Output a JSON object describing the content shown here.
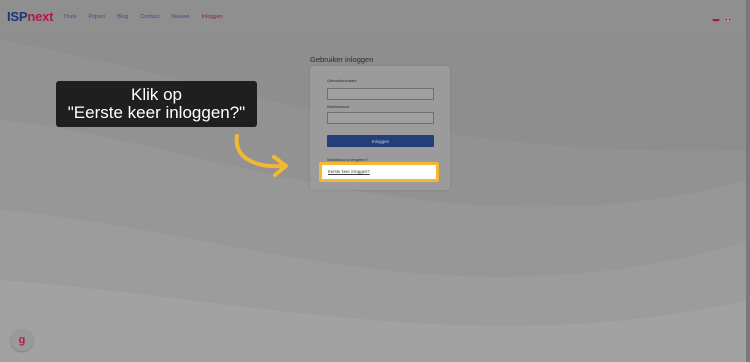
{
  "header": {
    "logo_part1": "ISP",
    "logo_part2": "next",
    "nav": [
      "Thuis",
      "Prijzen",
      "Blog",
      "Contact",
      "Nieuwe",
      "Inloggen"
    ]
  },
  "login": {
    "title": "Gebruiker inloggen",
    "username_label": "Gebruikersnaam",
    "password_label": "Wachtwoord",
    "submit_label": "Inloggen",
    "forgot_text": "Wachtwoord vergeten?",
    "first_login_link": "Eerste keer inloggen?"
  },
  "callout": {
    "line1": "Klik op",
    "line2": "\"Eerste keer inloggen?\""
  },
  "help_button": "g",
  "colors": {
    "accent_highlight": "#f4b731",
    "brand_blue": "#1d3578",
    "brand_red": "#b11845",
    "button_blue": "#233e78",
    "callout_bg": "#1f1f1f"
  },
  "icons": [
    "dutch-flag-icon",
    "uk-flag-icon",
    "curved-arrow-icon",
    "help-icon"
  ]
}
